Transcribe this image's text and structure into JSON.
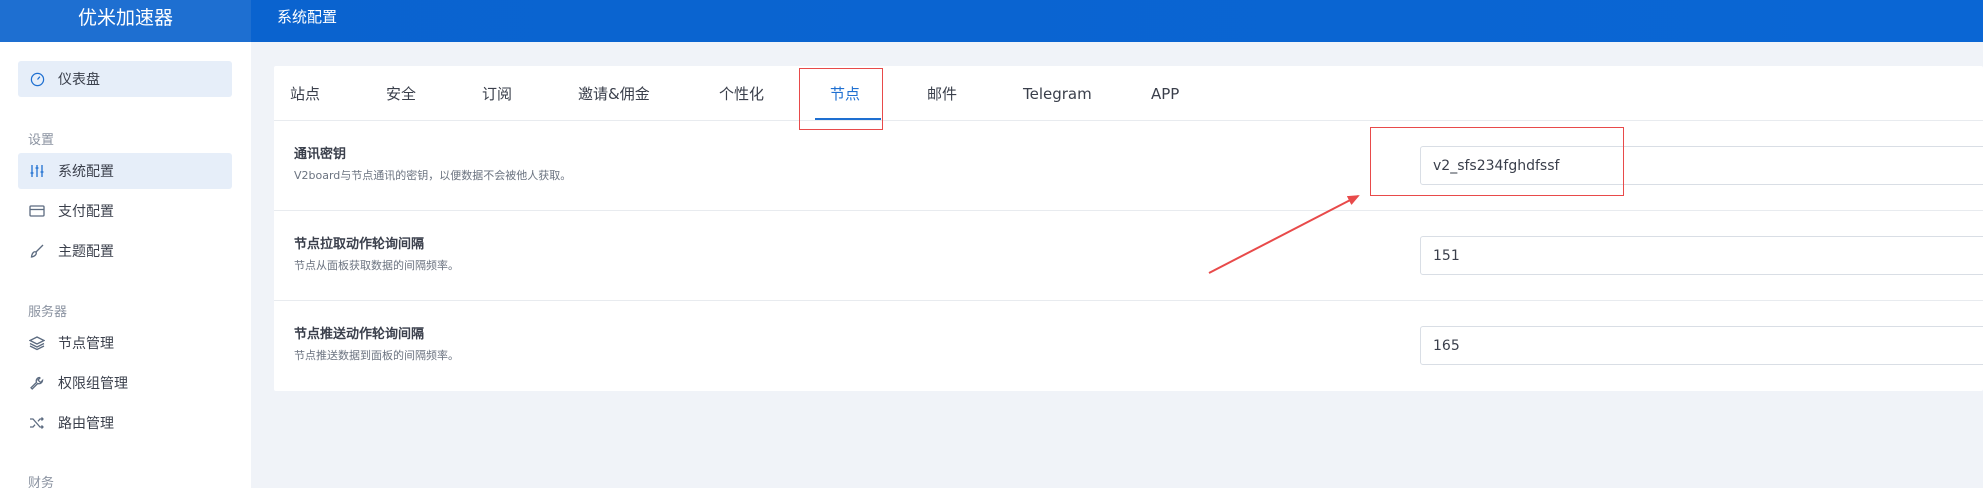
{
  "app": {
    "name": "优米加速器"
  },
  "topbar": {
    "title": "系统配置"
  },
  "sidebar": {
    "items": [
      {
        "label": "仪表盘",
        "icon": "dashboard-icon",
        "active": true
      },
      {
        "group": "设置"
      },
      {
        "label": "系统配置",
        "icon": "sliders-icon",
        "active": true
      },
      {
        "label": "支付配置",
        "icon": "credit-card-icon",
        "active": false
      },
      {
        "label": "主题配置",
        "icon": "brush-icon",
        "active": false
      },
      {
        "group": "服务器"
      },
      {
        "label": "节点管理",
        "icon": "layers-icon",
        "active": false
      },
      {
        "label": "权限组管理",
        "icon": "wrench-icon",
        "active": false
      },
      {
        "label": "路由管理",
        "icon": "shuffle-icon",
        "active": false
      },
      {
        "group": "财务"
      }
    ]
  },
  "tabs": [
    {
      "label": "站点"
    },
    {
      "label": "安全"
    },
    {
      "label": "订阅"
    },
    {
      "label": "邀请&佣金"
    },
    {
      "label": "个性化"
    },
    {
      "label": "节点",
      "active": true
    },
    {
      "label": "邮件"
    },
    {
      "label": "Telegram"
    },
    {
      "label": "APP"
    }
  ],
  "settings": [
    {
      "label": "通讯密钥",
      "desc": "V2board与节点通讯的密钥，以便数据不会被他人获取。",
      "value": "v2_sfs234fghdfssf"
    },
    {
      "label": "节点拉取动作轮询间隔",
      "desc": "节点从面板获取数据的间隔频率。",
      "value": "151"
    },
    {
      "label": "节点推送动作轮询间隔",
      "desc": "节点推送数据到面板的间隔频率。",
      "value": "165"
    }
  ],
  "colors": {
    "accent": "#1e6fd1",
    "header": "#0a63cf",
    "annotation": "#e84a4a"
  }
}
